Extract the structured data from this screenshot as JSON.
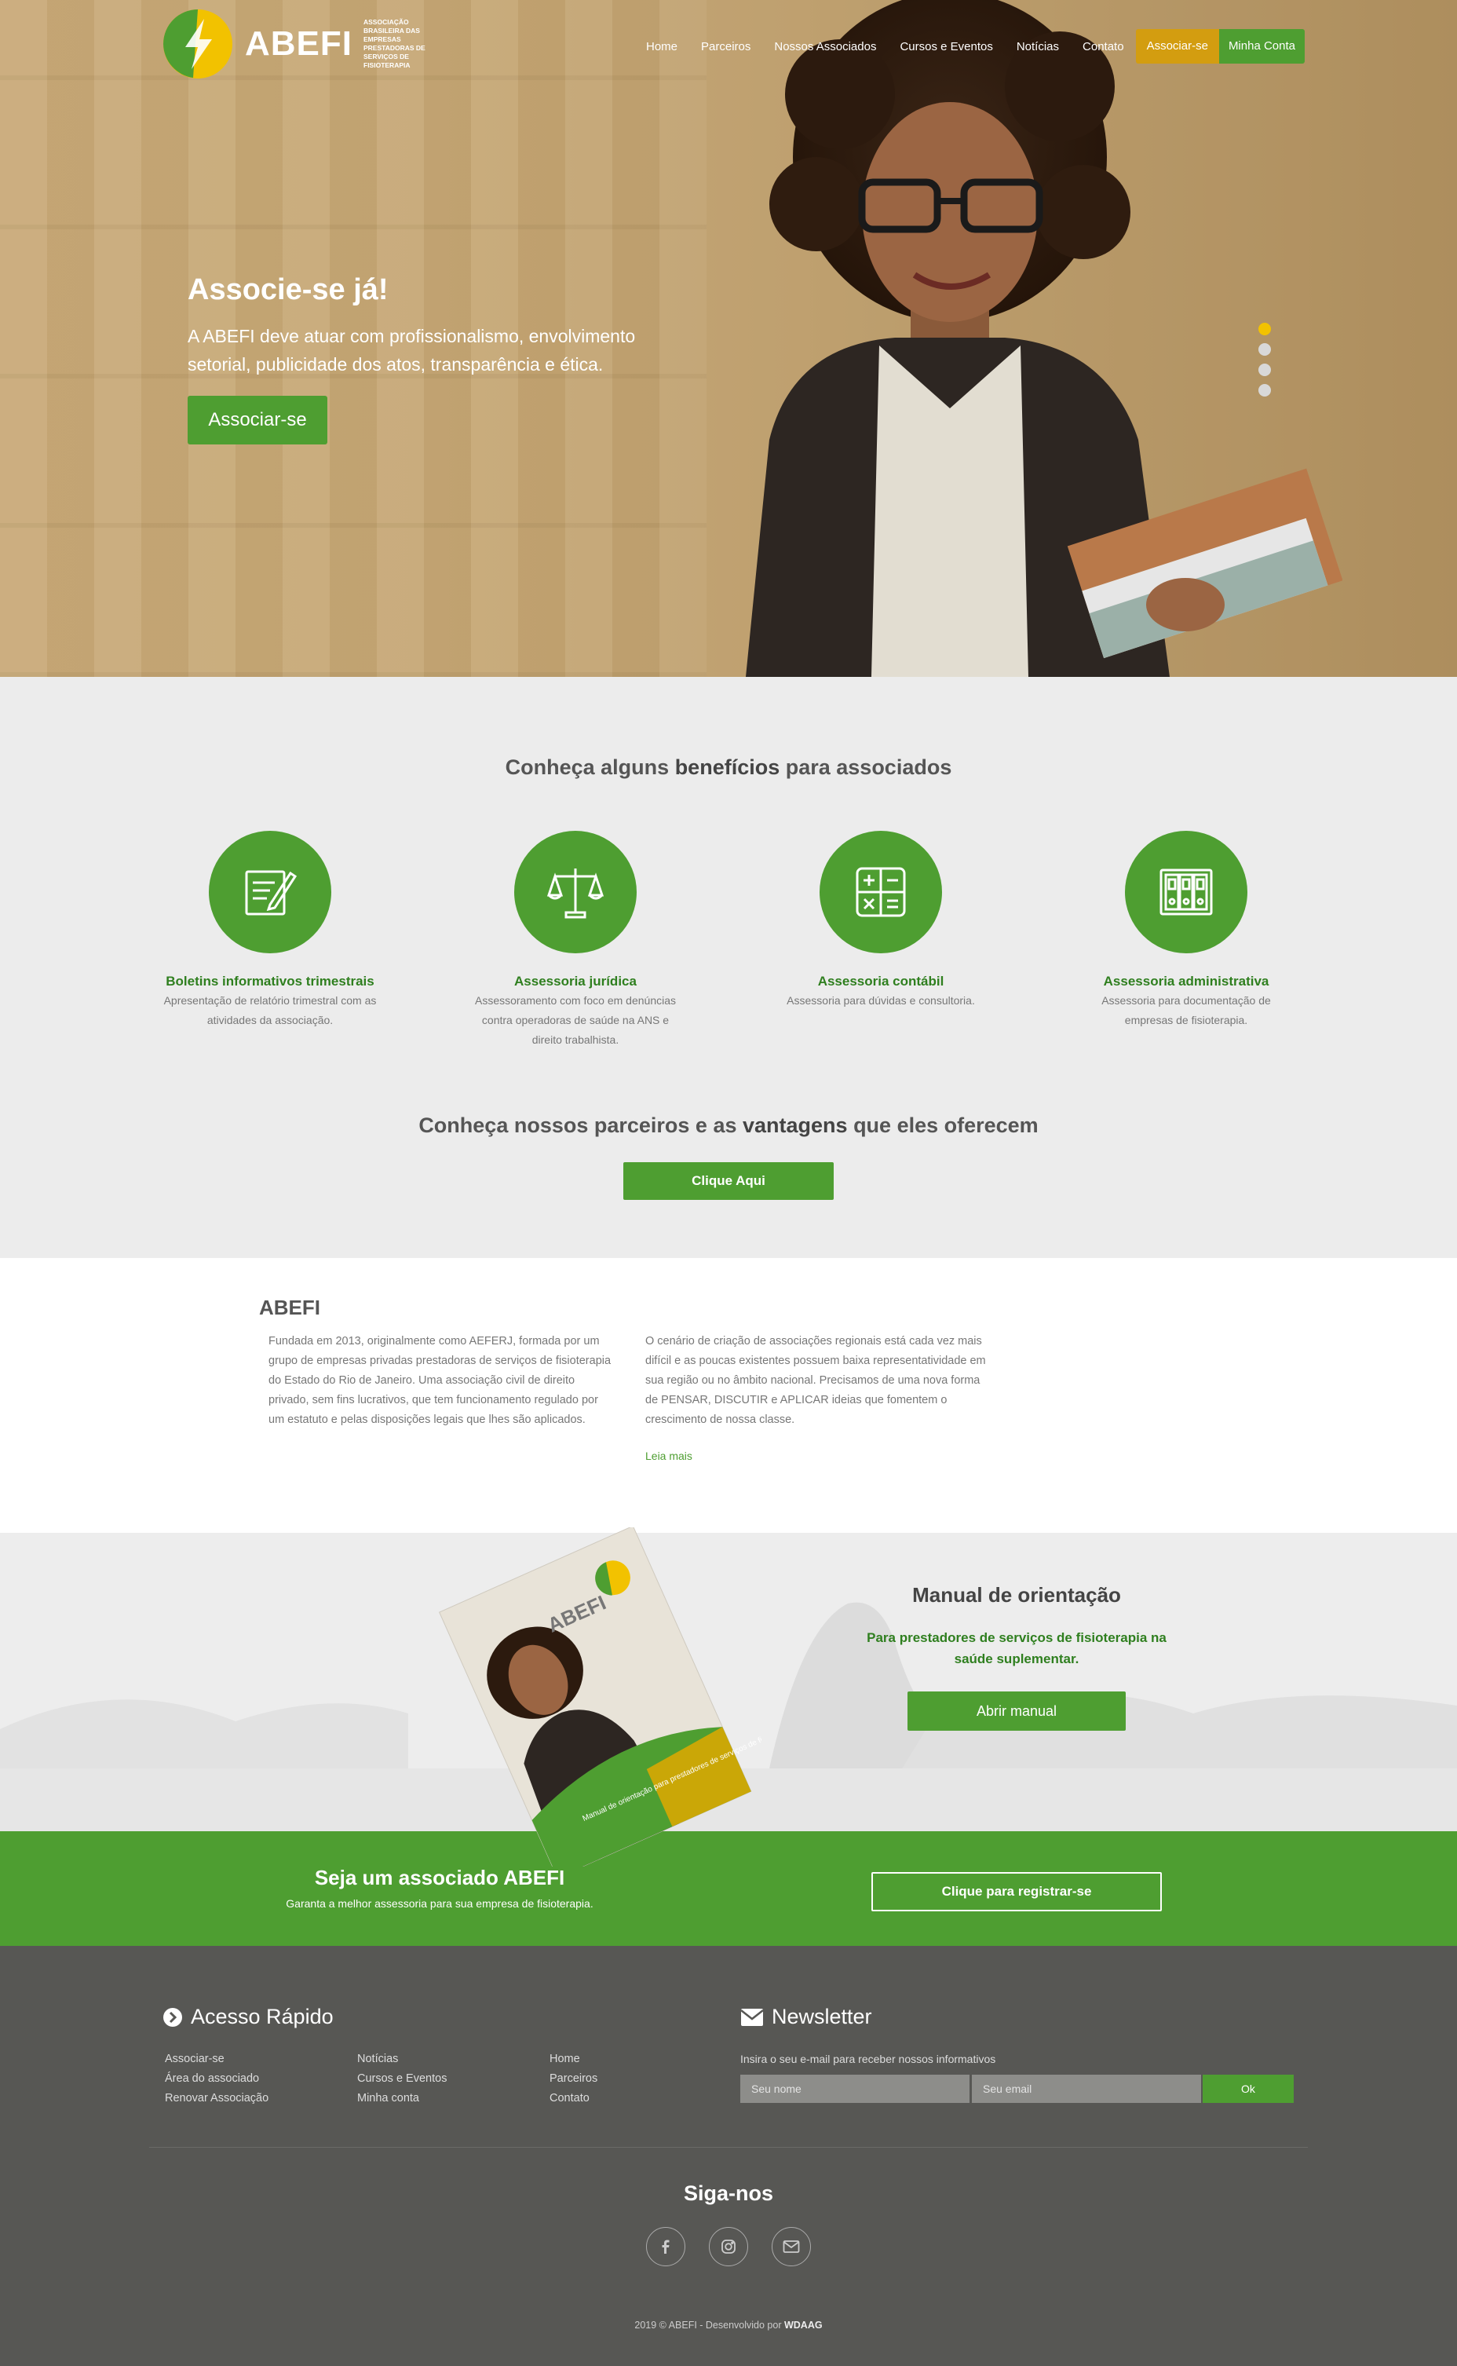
{
  "brand": {
    "name": "ABEFI",
    "subtitle": "ASSOCIAÇÃO BRASILEIRA DAS EMPRESAS PRESTADORAS DE SERVIÇOS DE FISIOTERAPIA",
    "green": "#4e9e31",
    "yellow": "#d39d10"
  },
  "nav": {
    "items": [
      "Home",
      "Parceiros",
      "Nossos Associados",
      "Cursos e Eventos",
      "Notícias",
      "Contato"
    ],
    "associate_label": "Associar-se",
    "account_label": "Minha Conta"
  },
  "hero": {
    "title": "Associe-se já!",
    "text": "A ABEFI deve atuar com profissionalismo, envolvimento setorial, publicidade dos atos, transparência e ética.",
    "button_label": "Associar-se",
    "slides": 4,
    "active_slide": 1
  },
  "benefits": {
    "title_pre": "Conheça alguns ",
    "title_bold": "benefícios",
    "title_post": " para associados",
    "items": [
      {
        "title": "Boletins informativos trimestrais",
        "desc": "Apresentação de relatório trimestral com as atividades da associação.",
        "icon": "document-pen-icon"
      },
      {
        "title": "Assessoria jurídica",
        "desc": "Assessoramento com foco em denúncias contra operadoras de saúde na ANS e direito trabalhista.",
        "icon": "scale-icon"
      },
      {
        "title": "Assessoria contábil",
        "desc": "Assessoria para dúvidas e consultoria.",
        "icon": "calculator-icon"
      },
      {
        "title": "Assessoria administrativa",
        "desc": "Assessoria para documentação de empresas de fisioterapia.",
        "icon": "binders-icon"
      }
    ]
  },
  "partners": {
    "title_pre": "Conheça nossos parceiros e as ",
    "title_bold": "vantagens",
    "title_post": " que eles oferecem",
    "button_label": "Clique Aqui"
  },
  "about": {
    "title": "ABEFI",
    "col1": "Fundada em 2013, originalmente como AEFERJ, formada por um grupo de empresas privadas prestadoras de serviços de fisioterapia do Estado do Rio de Janeiro. Uma associação civil de direito privado, sem fins lucrativos, que tem funcionamento regulado por um estatuto e pelas disposições legais que lhes são aplicados.",
    "col2": "O cenário de criação de associações regionais está cada vez mais difícil e as poucas existentes possuem baixa representatividade em sua região ou no âmbito nacional. Precisamos de uma nova forma de PENSAR, DISCUTIR e APLICAR ideias que fomentem o crescimento de nossa classe.",
    "read_more": "Leia mais"
  },
  "manual": {
    "title": "Manual de orientação",
    "subtitle": "Para prestadores de serviços de fisioterapia na saúde suplementar.",
    "button_label": "Abrir manual",
    "cover_brand": "ABEFI",
    "cover_text": "Manual de orientação para prestadores de serviços de fisioterapia na Saúde Suplementar"
  },
  "cta": {
    "title_pre": "Seja um associado ",
    "title_bold": "ABEFI",
    "subtitle": "Garanta a melhor assessoria para sua empresa de fisioterapia.",
    "button_label": "Clique para registrar-se"
  },
  "footer": {
    "quick_title": "Acesso Rápido",
    "quick_links": [
      [
        "Associar-se",
        "Área do associado",
        "Renovar Associação"
      ],
      [
        "Notícias",
        "Cursos e Eventos",
        "Minha conta"
      ],
      [
        "Home",
        "Parceiros",
        "Contato"
      ]
    ],
    "newsletter_title": "Newsletter",
    "newsletter_label": "Insira o seu e-mail para receber nossos informativos",
    "name_placeholder": "Seu nome",
    "email_placeholder": "Seu email",
    "ok_label": "Ok",
    "follow_title": "Siga-nos",
    "social": [
      "facebook-icon",
      "instagram-icon",
      "mail-icon"
    ],
    "copyright": "2019 © ABEFI - Desenvolvido por",
    "developer": "WDAAG"
  }
}
